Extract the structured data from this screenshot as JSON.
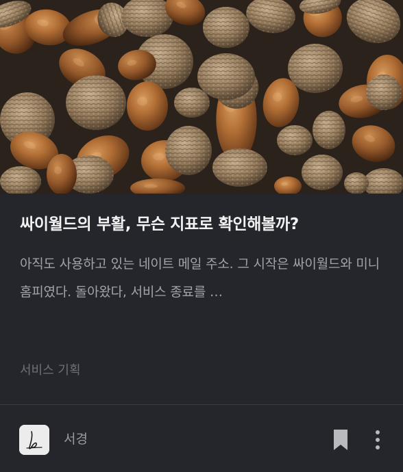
{
  "post": {
    "thumbnail_alt": "acorns",
    "title": "싸이월드의 부활, 무슨 지표로 확인해볼까?",
    "excerpt": "아직도 사용하고 있는 네이트 메일 주소. 그 시작은 싸이월드와 미니홈피였다. 돌아왔다, 서비스 종료를 …",
    "category": "서비스 기획"
  },
  "footer": {
    "author_name": "서경",
    "avatar_icon": "signature-icon",
    "bookmark_icon": "bookmark-icon",
    "more_icon": "more-vertical-icon"
  },
  "colors": {
    "background": "#25262b",
    "title": "#f2f2f3",
    "excerpt": "#a2a3a8",
    "category": "#6f7076",
    "icon": "#b9babe"
  }
}
